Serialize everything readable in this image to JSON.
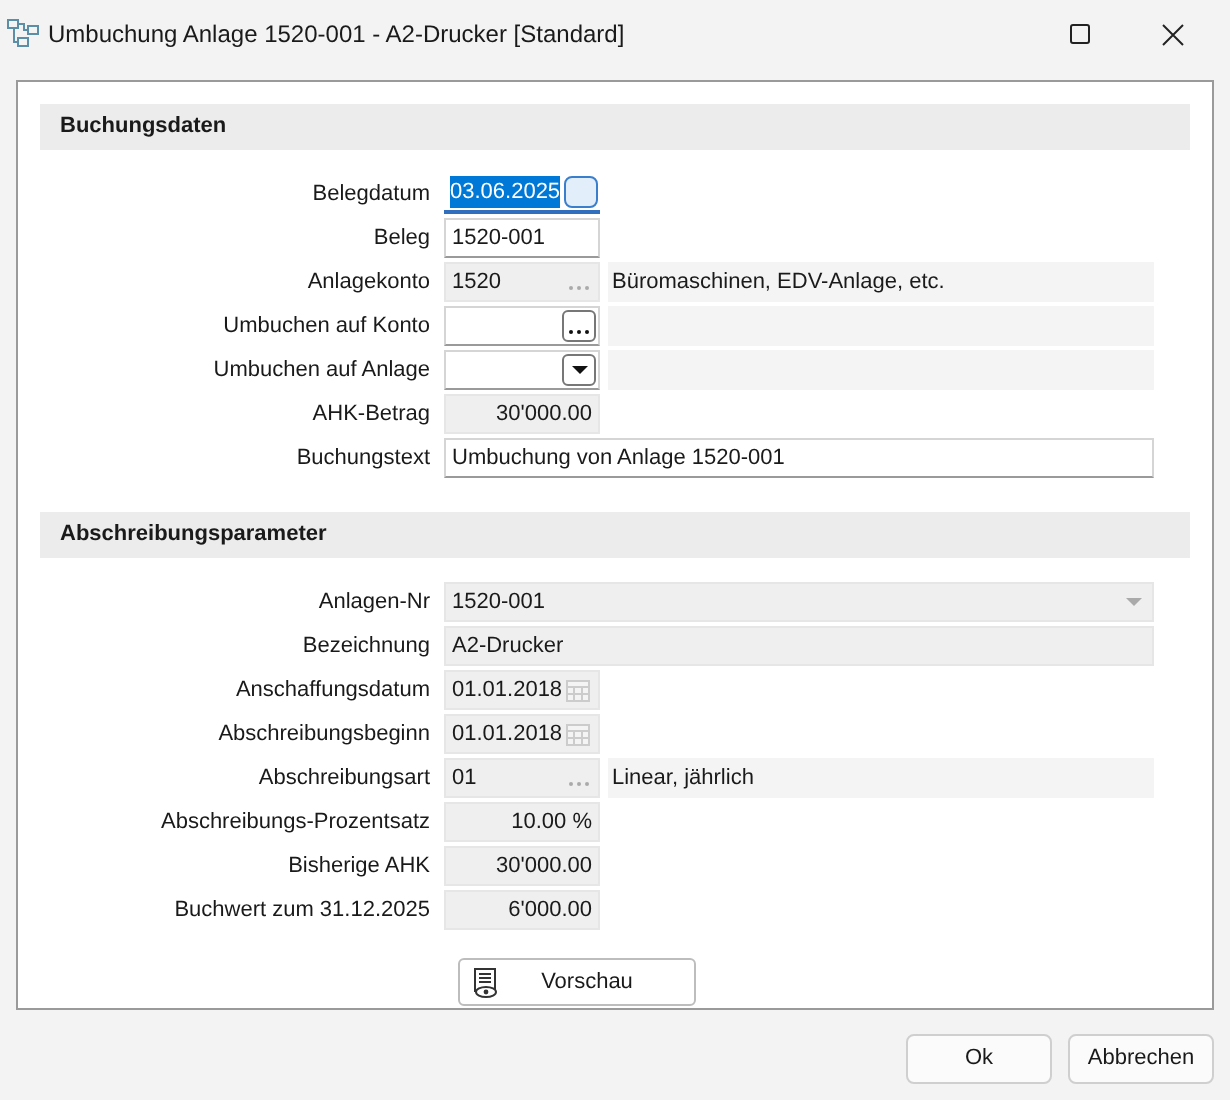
{
  "window": {
    "title": "Umbuchung Anlage 1520-001 - A2-Drucker [Standard]"
  },
  "sections": [
    {
      "title": "Buchungsdaten",
      "rows": [
        {
          "label": "Belegdatum",
          "kind": "date",
          "value": "03.06.2025",
          "editable": true,
          "focused": true
        },
        {
          "label": "Beleg",
          "kind": "text",
          "value": "1520-001",
          "editable": true,
          "focused": false
        },
        {
          "label": "Anlagekonto",
          "kind": "lookup",
          "value": "1520",
          "editable": false,
          "focused": false,
          "description": "Büromaschinen, EDV-Anlage, etc."
        },
        {
          "label": "Umbuchen auf Konto",
          "kind": "lookup",
          "editable": true,
          "focused": false
        },
        {
          "label": "Umbuchen auf Anlage",
          "kind": "dropdown",
          "editable": true,
          "focused": false
        },
        {
          "label": "AHK-Betrag",
          "kind": "number",
          "value": "30'000.00",
          "editable": false,
          "focused": false
        },
        {
          "label": "Buchungstext",
          "kind": "wide_text",
          "value": "Umbuchung von Anlage 1520-001",
          "editable": true,
          "focused": false
        }
      ]
    },
    {
      "title": "Abschreibungsparameter",
      "rows": [
        {
          "label": "Anlagen-Nr",
          "kind": "wide_combo",
          "value": "1520-001",
          "editable": false,
          "focused": false
        },
        {
          "label": "Bezeichnung",
          "kind": "wide_text",
          "value": "A2-Drucker",
          "editable": false,
          "focused": false
        },
        {
          "label": "Anschaffungsdatum",
          "kind": "date",
          "value": "01.01.2018",
          "editable": false,
          "focused": false
        },
        {
          "label": "Abschreibungsbeginn",
          "kind": "date",
          "value": "01.01.2018",
          "editable": false,
          "focused": false
        },
        {
          "label": "Abschreibungsart",
          "kind": "lookup",
          "value": "01",
          "editable": false,
          "focused": false,
          "description": "Linear, jährlich"
        },
        {
          "label": "Abschreibungs-Prozentsatz",
          "kind": "number",
          "value": "10.00 %",
          "editable": false,
          "focused": false
        },
        {
          "label": "Bisherige AHK",
          "kind": "number",
          "value": "30'000.00",
          "editable": false,
          "focused": false
        },
        {
          "label": "Buchwert zum 31.12.2025",
          "kind": "number",
          "value": "6'000.00",
          "editable": false,
          "focused": false
        }
      ]
    }
  ],
  "preview_button": {
    "label": "Vorschau"
  },
  "buttons": [
    "Ok",
    "Abbrechen"
  ]
}
